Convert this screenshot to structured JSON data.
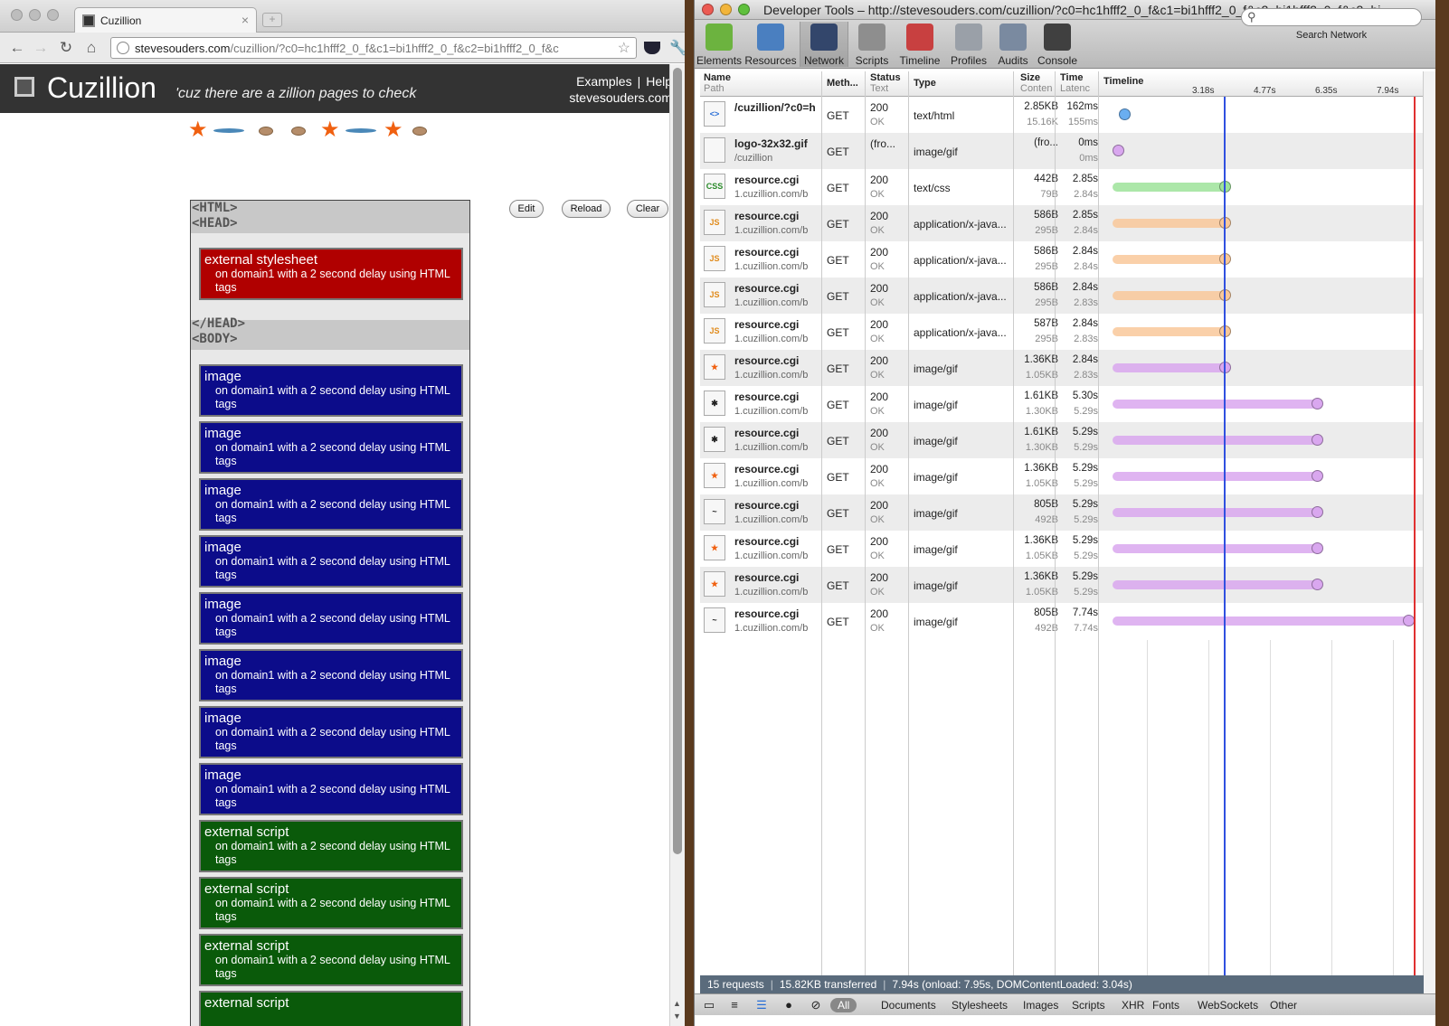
{
  "browser": {
    "tab_title": "Cuzillion",
    "tab_close": "×",
    "new_tab": "+",
    "url_domain": "stevesouders.com",
    "url_rest": "/cuzillion/?c0=hc1hfff2_0_f&c1=bi1hfff2_0_f&c2=bi1hfff2_0_f&c",
    "back": "←",
    "forward": "→",
    "reload": "↻",
    "home": "⌂",
    "bookmark": "☆",
    "wrench": "🔧"
  },
  "page": {
    "title": "Cuzillion",
    "tagline": "'cuz there are a zillion pages to check",
    "links": {
      "examples": "Examples",
      "sep": "|",
      "help": "Help",
      "site": "stevesouders.com"
    },
    "buttons": {
      "edit": "Edit",
      "reload": "Reload",
      "clear": "Clear"
    },
    "tags": {
      "html_open": "<HTML>",
      "head_open": "<HEAD>",
      "head_close": "</HEAD>",
      "body_open": "<BODY>"
    },
    "head_resources": [
      {
        "title": "external stylesheet",
        "desc": "on domain1 with a 2 second delay using HTML tags"
      }
    ],
    "body_resources": [
      {
        "title": "image",
        "desc": "on domain1 with a 2 second delay using HTML tags"
      },
      {
        "title": "image",
        "desc": "on domain1 with a 2 second delay using HTML tags"
      },
      {
        "title": "image",
        "desc": "on domain1 with a 2 second delay using HTML tags"
      },
      {
        "title": "image",
        "desc": "on domain1 with a 2 second delay using HTML tags"
      },
      {
        "title": "image",
        "desc": "on domain1 with a 2 second delay using HTML tags"
      },
      {
        "title": "image",
        "desc": "on domain1 with a 2 second delay using HTML tags"
      },
      {
        "title": "image",
        "desc": "on domain1 with a 2 second delay using HTML tags"
      },
      {
        "title": "image",
        "desc": "on domain1 with a 2 second delay using HTML tags"
      },
      {
        "title": "external script",
        "desc": "on domain1 with a 2 second delay using HTML tags"
      },
      {
        "title": "external script",
        "desc": "on domain1 with a 2 second delay using HTML tags"
      },
      {
        "title": "external script",
        "desc": "on domain1 with a 2 second delay using HTML tags"
      },
      {
        "title": "external script",
        "desc": ""
      }
    ],
    "colors": {
      "stylesheet": "#b00000",
      "image": "#0c0c8a",
      "script": "#0a5a0a",
      "header": "#333333"
    }
  },
  "devtools": {
    "title": "Developer Tools – http://stevesouders.com/cuzillion/?c0=hc1hfff2_0_f&c1=bi1hfff2_0_f&c2=bi1hfff2_0_f&c3=bi...",
    "toolbar": [
      "Elements",
      "Resources",
      "Network",
      "Scripts",
      "Timeline",
      "Profiles",
      "Audits",
      "Console"
    ],
    "search_label": "Search Network",
    "search_icon": "⚲",
    "columns": {
      "name": "Name",
      "path": "Path",
      "method": "Meth...",
      "status": "Status",
      "status_text": "Text",
      "type": "Type",
      "size": "Size",
      "content": "Conten",
      "time": "Time",
      "latency": "Latenc",
      "timeline": "Timeline"
    },
    "ticks": [
      "3.18s",
      "4.77s",
      "6.35s",
      "7.94s"
    ],
    "rows": [
      {
        "icon": "<>",
        "name": "/cuzillion/?c0=h",
        "path": "",
        "method": "GET",
        "status": "200",
        "status_text": "OK",
        "type": "text/html",
        "size": "2.85KB",
        "content": "15.16K",
        "time": "162ms",
        "latency": "155ms"
      },
      {
        "icon": "",
        "name": "logo-32x32.gif",
        "path": "/cuzillion",
        "method": "GET",
        "status": "(fro...",
        "status_text": "",
        "type": "image/gif",
        "size": "(fro...",
        "content": "",
        "time": "0ms",
        "latency": "0ms"
      },
      {
        "icon": "CSS",
        "name": "resource.cgi",
        "path": "1.cuzillion.com/b",
        "method": "GET",
        "status": "200",
        "status_text": "OK",
        "type": "text/css",
        "size": "442B",
        "content": "79B",
        "time": "2.85s",
        "latency": "2.84s"
      },
      {
        "icon": "JS",
        "name": "resource.cgi",
        "path": "1.cuzillion.com/b",
        "method": "GET",
        "status": "200",
        "status_text": "OK",
        "type": "application/x-java...",
        "size": "586B",
        "content": "295B",
        "time": "2.85s",
        "latency": "2.84s"
      },
      {
        "icon": "JS",
        "name": "resource.cgi",
        "path": "1.cuzillion.com/b",
        "method": "GET",
        "status": "200",
        "status_text": "OK",
        "type": "application/x-java...",
        "size": "586B",
        "content": "295B",
        "time": "2.84s",
        "latency": "2.84s"
      },
      {
        "icon": "JS",
        "name": "resource.cgi",
        "path": "1.cuzillion.com/b",
        "method": "GET",
        "status": "200",
        "status_text": "OK",
        "type": "application/x-java...",
        "size": "586B",
        "content": "295B",
        "time": "2.84s",
        "latency": "2.83s"
      },
      {
        "icon": "JS",
        "name": "resource.cgi",
        "path": "1.cuzillion.com/b",
        "method": "GET",
        "status": "200",
        "status_text": "OK",
        "type": "application/x-java...",
        "size": "587B",
        "content": "295B",
        "time": "2.84s",
        "latency": "2.83s"
      },
      {
        "icon": "★",
        "name": "resource.cgi",
        "path": "1.cuzillion.com/b",
        "method": "GET",
        "status": "200",
        "status_text": "OK",
        "type": "image/gif",
        "size": "1.36KB",
        "content": "1.05KB",
        "time": "2.84s",
        "latency": "2.83s"
      },
      {
        "icon": "✱",
        "name": "resource.cgi",
        "path": "1.cuzillion.com/b",
        "method": "GET",
        "status": "200",
        "status_text": "OK",
        "type": "image/gif",
        "size": "1.61KB",
        "content": "1.30KB",
        "time": "5.30s",
        "latency": "5.29s"
      },
      {
        "icon": "✱",
        "name": "resource.cgi",
        "path": "1.cuzillion.com/b",
        "method": "GET",
        "status": "200",
        "status_text": "OK",
        "type": "image/gif",
        "size": "1.61KB",
        "content": "1.30KB",
        "time": "5.29s",
        "latency": "5.29s"
      },
      {
        "icon": "★",
        "name": "resource.cgi",
        "path": "1.cuzillion.com/b",
        "method": "GET",
        "status": "200",
        "status_text": "OK",
        "type": "image/gif",
        "size": "1.36KB",
        "content": "1.05KB",
        "time": "5.29s",
        "latency": "5.29s"
      },
      {
        "icon": "~",
        "name": "resource.cgi",
        "path": "1.cuzillion.com/b",
        "method": "GET",
        "status": "200",
        "status_text": "OK",
        "type": "image/gif",
        "size": "805B",
        "content": "492B",
        "time": "5.29s",
        "latency": "5.29s"
      },
      {
        "icon": "★",
        "name": "resource.cgi",
        "path": "1.cuzillion.com/b",
        "method": "GET",
        "status": "200",
        "status_text": "OK",
        "type": "image/gif",
        "size": "1.36KB",
        "content": "1.05KB",
        "time": "5.29s",
        "latency": "5.29s"
      },
      {
        "icon": "★",
        "name": "resource.cgi",
        "path": "1.cuzillion.com/b",
        "method": "GET",
        "status": "200",
        "status_text": "OK",
        "type": "image/gif",
        "size": "1.36KB",
        "content": "1.05KB",
        "time": "5.29s",
        "latency": "5.29s"
      },
      {
        "icon": "~",
        "name": "resource.cgi",
        "path": "1.cuzillion.com/b",
        "method": "GET",
        "status": "200",
        "status_text": "OK",
        "type": "image/gif",
        "size": "805B",
        "content": "492B",
        "time": "7.74s",
        "latency": "7.74s"
      }
    ],
    "status_bar": {
      "requests": "15 requests",
      "transferred": "15.82KB transferred",
      "timing": "7.94s (onload: 7.95s, DOMContentLoaded: 3.04s)"
    },
    "filters": [
      "All",
      "Documents",
      "Stylesheets",
      "Images",
      "Scripts",
      "XHR",
      "Fonts",
      "WebSockets",
      "Other"
    ],
    "colors": {
      "html": "#6aaef0",
      "css": "#9ee39a",
      "js": "#f9c89a",
      "img": "#d9a7ef",
      "dom_line": "#3050e0",
      "load_line": "#e03030"
    }
  }
}
